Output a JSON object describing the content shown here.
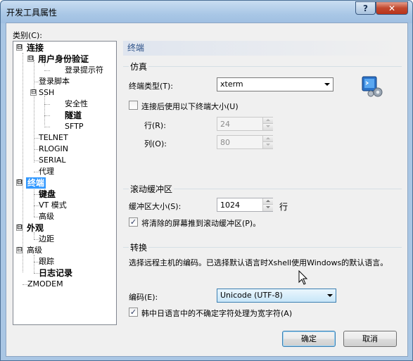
{
  "window": {
    "title": "开发工具属性"
  },
  "title_buttons": {
    "help": "?"
  },
  "category_label": "类别(C):",
  "tree": [
    {
      "label": "连接",
      "expander": "⊟"
    },
    {
      "label": "用户身份验证",
      "expander": "⊟"
    },
    {
      "label": "登录提示符"
    },
    {
      "label": "登录脚本"
    },
    {
      "label": "SSH",
      "expander": "⊟"
    },
    {
      "label": "安全性"
    },
    {
      "label": "隧道"
    },
    {
      "label": "SFTP"
    },
    {
      "label": "TELNET"
    },
    {
      "label": "RLOGIN"
    },
    {
      "label": "SERIAL"
    },
    {
      "label": "代理"
    },
    {
      "label": "终端",
      "expander": "⊟",
      "selected": true
    },
    {
      "label": "键盘"
    },
    {
      "label": "VT 模式"
    },
    {
      "label": "高级"
    },
    {
      "label": "外观",
      "expander": "⊟"
    },
    {
      "label": "边距"
    },
    {
      "label": "高级",
      "expander": "⊟"
    },
    {
      "label": "跟踪"
    },
    {
      "label": "日志记录"
    },
    {
      "label": "ZMODEM"
    }
  ],
  "panel": {
    "header": "终端",
    "emulation": {
      "title": "仿真",
      "terminal_type_label": "终端类型(T):",
      "terminal_type_value": "xterm",
      "use_size_label": "连接后使用以下终端大小(U)",
      "use_size_checked": false,
      "rows_label": "行(R):",
      "rows_value": "24",
      "cols_label": "列(O):",
      "cols_value": "80"
    },
    "scroll": {
      "title": "滚动缓冲区",
      "buffer_label": "缓冲区大小(S):",
      "buffer_value": "1024",
      "buffer_unit": "行",
      "push_label": "将清除的屏幕推到滚动缓冲区(P)。",
      "push_checked": true
    },
    "translation": {
      "title": "转换",
      "description": "选择远程主机的编码。已选择默认语言时Xshell使用Windows的默认语言。",
      "encoding_label": "编码(E):",
      "encoding_value": "Unicode (UTF-8)",
      "cjk_label": "韩中日语言中的不确定字符处理为宽字符(A)",
      "cjk_checked": true
    }
  },
  "buttons": {
    "ok": "确定",
    "cancel": "取消"
  },
  "colors": {
    "selection": "#3399ff",
    "header_text": "#2a4f87",
    "window_frame": "#a9c6e4"
  }
}
